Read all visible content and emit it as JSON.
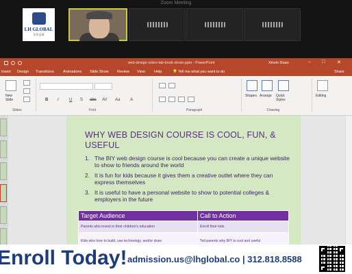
{
  "zoom": {
    "window_title": "Zoom Meeting",
    "logo_name": "LH GLOBAL",
    "logo_subtext": "乐华全球",
    "participants": [
      "",
      "",
      "",
      "",
      ""
    ]
  },
  "powerpoint": {
    "file_title": "web-design-video-lab-book-xinxin.pptx  -  PowerPoint",
    "user": "Xinxin Duan",
    "tabs": [
      "Insert",
      "Design",
      "Transitions",
      "Animations",
      "Slide Show",
      "Review",
      "View",
      "Help"
    ],
    "tell_me": "Tell me what you want to do",
    "share": "Share",
    "ribbon": {
      "new_slide": "New Slide",
      "groups": [
        "Slides",
        "Font",
        "Paragraph",
        "Drawing"
      ],
      "shapes": "Shapes",
      "arrange": "Arrange",
      "quick_styles": "Quick Styles",
      "editing": "Editing",
      "format_buttons": [
        "B",
        "I",
        "U",
        "S",
        "abc",
        "AV",
        "Aa",
        "A"
      ]
    }
  },
  "slide": {
    "title": "WHY WEB DESIGN COURSE IS COOL, FUN, & USEFUL",
    "bullets": [
      {
        "num": "1.",
        "text": "The BIY web design course is cool because you can create a unique website to show to friends around the world"
      },
      {
        "num": "2.",
        "text": "It is fun for kids because it gives them a creative outlet where they can express themselves"
      },
      {
        "num": "3.",
        "text": "It is useful to have a personal website to show to potential colleges & employers in the future"
      }
    ],
    "table": {
      "headers": [
        "Target Audience",
        "Call to Action"
      ],
      "rows": [
        [
          "Parents who invest in their children's education",
          "Enroll their kids"
        ],
        [
          "Kids who love to build, use technology, and/or draw",
          "Tell parents why BIY is cool and useful"
        ]
      ]
    }
  },
  "banner": {
    "enroll": "Enroll Today!",
    "contact": "admission.us@lhglobal.co | 312.818.8588"
  },
  "colors": {
    "ppt_accent": "#b7472a",
    "slide_bg": "#d5e8c4",
    "slide_text": "#5b2a86",
    "table_header": "#7030a0",
    "banner_text": "#1c3c7c"
  }
}
